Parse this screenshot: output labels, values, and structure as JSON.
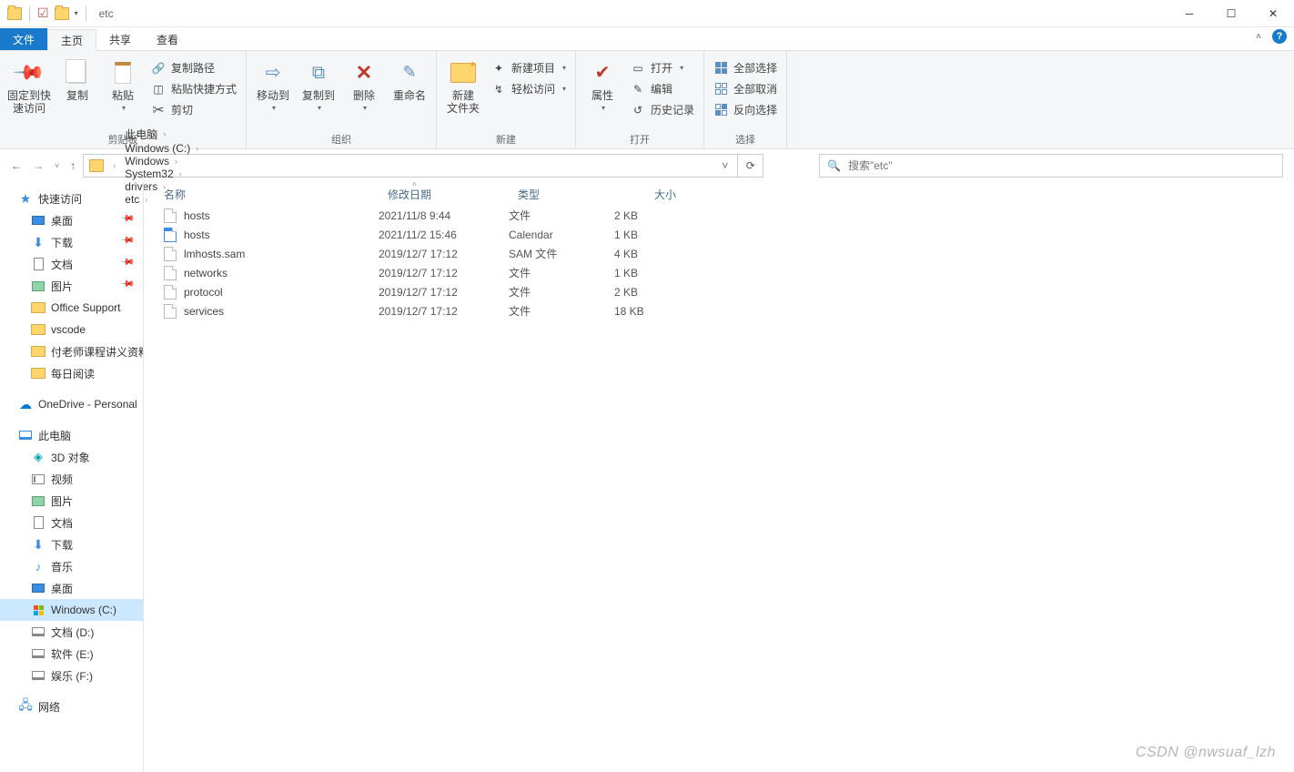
{
  "window": {
    "title": "etc"
  },
  "tabs": {
    "file": "文件",
    "home": "主页",
    "share": "共享",
    "view": "查看"
  },
  "ribbon": {
    "clipboard": {
      "pin": "固定到快\n速访问",
      "copy": "复制",
      "paste": "粘贴",
      "copypath": "复制路径",
      "pasteshortcut": "粘贴快捷方式",
      "cut": "剪切",
      "label": "剪贴板"
    },
    "organize": {
      "moveto": "移动到",
      "copyto": "复制到",
      "delete": "删除",
      "rename": "重命名",
      "label": "组织"
    },
    "new": {
      "newfolder": "新建\n文件夹",
      "newitem": "新建项目",
      "easyaccess": "轻松访问",
      "label": "新建"
    },
    "open": {
      "properties": "属性",
      "open": "打开",
      "edit": "编辑",
      "history": "历史记录",
      "label": "打开"
    },
    "select": {
      "selectall": "全部选择",
      "selectnone": "全部取消",
      "invert": "反向选择",
      "label": "选择"
    }
  },
  "breadcrumbs": [
    "此电脑",
    "Windows (C:)",
    "Windows",
    "System32",
    "drivers",
    "etc"
  ],
  "search": {
    "placeholder": "搜索\"etc\""
  },
  "columns": {
    "name": "名称",
    "date": "修改日期",
    "type": "类型",
    "size": "大小"
  },
  "files": [
    {
      "name": "hosts",
      "date": "2021/11/8 9:44",
      "type": "文件",
      "size": "2 KB",
      "icon": "file"
    },
    {
      "name": "hosts",
      "date": "2021/11/2 15:46",
      "type": "Calendar",
      "size": "1 KB",
      "icon": "cal"
    },
    {
      "name": "lmhosts.sam",
      "date": "2019/12/7 17:12",
      "type": "SAM 文件",
      "size": "4 KB",
      "icon": "file"
    },
    {
      "name": "networks",
      "date": "2019/12/7 17:12",
      "type": "文件",
      "size": "1 KB",
      "icon": "file"
    },
    {
      "name": "protocol",
      "date": "2019/12/7 17:12",
      "type": "文件",
      "size": "2 KB",
      "icon": "file"
    },
    {
      "name": "services",
      "date": "2019/12/7 17:12",
      "type": "文件",
      "size": "18 KB",
      "icon": "file"
    }
  ],
  "sidebar": {
    "quickaccess": {
      "label": "快速访问",
      "items": [
        {
          "label": "桌面",
          "pinned": true,
          "icon": "desktop"
        },
        {
          "label": "下载",
          "pinned": true,
          "icon": "download"
        },
        {
          "label": "文档",
          "pinned": true,
          "icon": "doc"
        },
        {
          "label": "图片",
          "pinned": true,
          "icon": "pic"
        },
        {
          "label": "Office Support",
          "pinned": false,
          "icon": "folder"
        },
        {
          "label": "vscode",
          "pinned": false,
          "icon": "folder"
        },
        {
          "label": "付老师课程讲义资料",
          "pinned": false,
          "icon": "folder"
        },
        {
          "label": "每日阅读",
          "pinned": false,
          "icon": "folder"
        }
      ]
    },
    "onedrive": {
      "label": "OneDrive - Personal"
    },
    "thispc": {
      "label": "此电脑",
      "items": [
        {
          "label": "3D 对象",
          "icon": "3d"
        },
        {
          "label": "视频",
          "icon": "video"
        },
        {
          "label": "图片",
          "icon": "pic"
        },
        {
          "label": "文档",
          "icon": "doc"
        },
        {
          "label": "下载",
          "icon": "download"
        },
        {
          "label": "音乐",
          "icon": "music"
        },
        {
          "label": "桌面",
          "icon": "desktop"
        },
        {
          "label": "Windows (C:)",
          "icon": "winlogo",
          "selected": true
        },
        {
          "label": "文档 (D:)",
          "icon": "drive"
        },
        {
          "label": "软件 (E:)",
          "icon": "drive"
        },
        {
          "label": "娱乐 (F:)",
          "icon": "drive"
        }
      ]
    },
    "network": {
      "label": "网络"
    }
  },
  "watermark": "CSDN @nwsuaf_lzh"
}
